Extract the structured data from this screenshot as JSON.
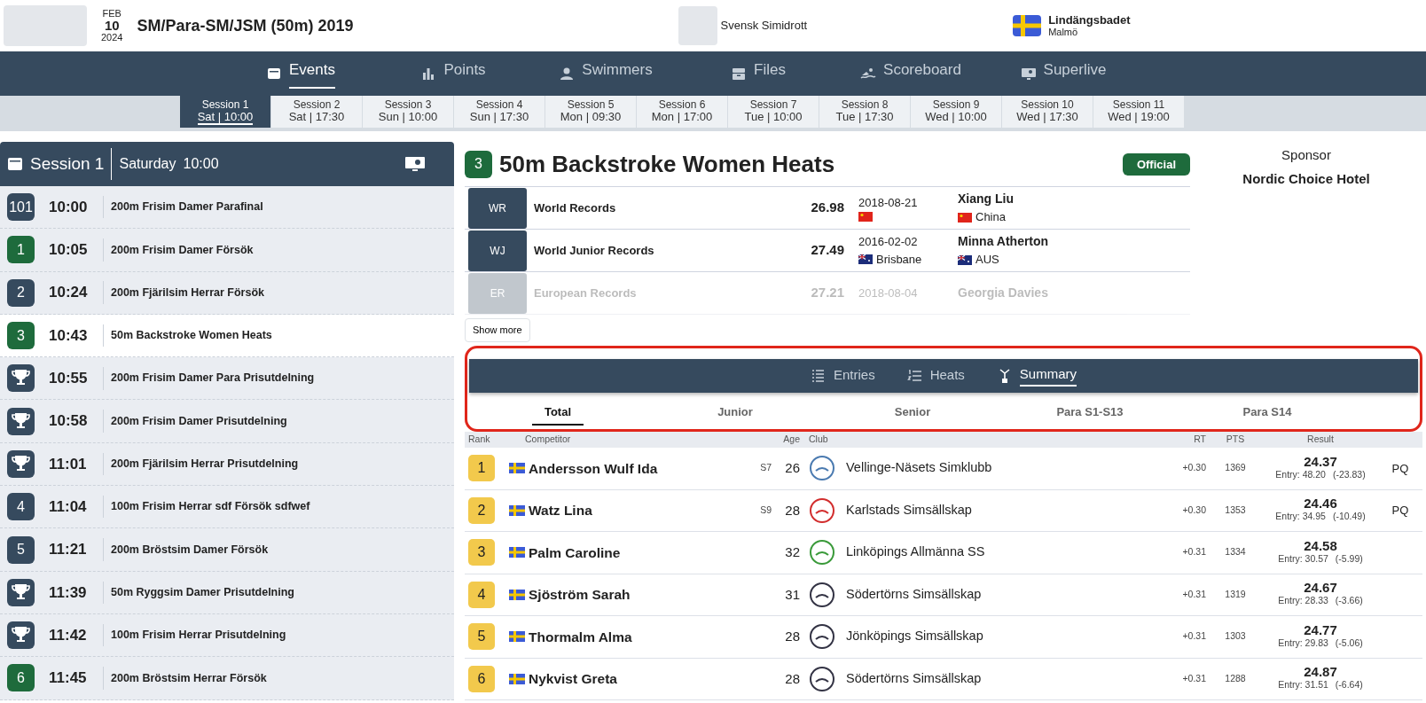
{
  "header": {
    "date": {
      "month": "FEB",
      "day": "10",
      "year": "2024"
    },
    "title": "SM/Para-SM/JSM (50m) 2019",
    "organizer": "Svensk Simidrott",
    "venue": {
      "name": "Lindängsbadet",
      "city": "Malmö"
    }
  },
  "nav": [
    {
      "label": "Events",
      "selected": true
    },
    {
      "label": "Points",
      "selected": false
    },
    {
      "label": "Swimmers",
      "selected": false
    },
    {
      "label": "Files",
      "selected": false
    },
    {
      "label": "Scoreboard",
      "selected": false
    },
    {
      "label": "Superlive",
      "selected": false
    }
  ],
  "sessions": [
    {
      "label": "Session 1",
      "time": "Sat | 10:00",
      "selected": true
    },
    {
      "label": "Session 2",
      "time": "Sat | 17:30",
      "selected": false
    },
    {
      "label": "Session 3",
      "time": "Sun | 10:00",
      "selected": false
    },
    {
      "label": "Session 4",
      "time": "Sun | 17:30",
      "selected": false
    },
    {
      "label": "Session 5",
      "time": "Mon | 09:30",
      "selected": false
    },
    {
      "label": "Session 6",
      "time": "Mon | 17:00",
      "selected": false
    },
    {
      "label": "Session 7",
      "time": "Tue | 10:00",
      "selected": false
    },
    {
      "label": "Session 8",
      "time": "Tue | 17:30",
      "selected": false
    },
    {
      "label": "Session 9",
      "time": "Wed | 10:00",
      "selected": false
    },
    {
      "label": "Session 10",
      "time": "Wed | 17:30",
      "selected": false
    },
    {
      "label": "Session 11",
      "time": "Wed | 19:00",
      "selected": false
    }
  ],
  "session_panel": {
    "title": "Session 1",
    "day": "Saturday",
    "time": "10:00"
  },
  "events": [
    {
      "kind": "number",
      "number": "101",
      "color": "#364a5e",
      "time": "10:00",
      "name": "200m Frisim Damer Parafinal",
      "selected": false
    },
    {
      "kind": "number",
      "number": "1",
      "color": "#1e6b3c",
      "time": "10:05",
      "name": "200m Frisim Damer Försök",
      "selected": false
    },
    {
      "kind": "number",
      "number": "2",
      "color": "#364a5e",
      "time": "10:24",
      "name": "200m Fjärilsim Herrar Försök",
      "selected": false
    },
    {
      "kind": "number",
      "number": "3",
      "color": "#1e6b3c",
      "time": "10:43",
      "name": "50m Backstroke Women Heats",
      "selected": true
    },
    {
      "kind": "award",
      "color": "#364a5e",
      "time": "10:55",
      "name": "200m Frisim Damer Para Prisutdelning",
      "selected": false
    },
    {
      "kind": "award",
      "color": "#364a5e",
      "time": "10:58",
      "name": "200m Frisim Damer Prisutdelning",
      "selected": false
    },
    {
      "kind": "award",
      "color": "#364a5e",
      "time": "11:01",
      "name": "200m Fjärilsim Herrar Prisutdelning",
      "selected": false
    },
    {
      "kind": "number",
      "number": "4",
      "color": "#364a5e",
      "time": "11:04",
      "name": "100m Frisim Herrar sdf Försök sdfwef",
      "selected": false
    },
    {
      "kind": "number",
      "number": "5",
      "color": "#364a5e",
      "time": "11:21",
      "name": "200m Bröstsim Damer Försök",
      "selected": false
    },
    {
      "kind": "award",
      "color": "#364a5e",
      "time": "11:39",
      "name": "50m Ryggsim Damer Prisutdelning",
      "selected": false
    },
    {
      "kind": "award",
      "color": "#364a5e",
      "time": "11:42",
      "name": "100m Frisim Herrar Prisutdelning",
      "selected": false
    },
    {
      "kind": "number",
      "number": "6",
      "color": "#1e6b3c",
      "time": "11:45",
      "name": "200m Bröstsim Herrar Försök",
      "selected": false
    }
  ],
  "event": {
    "number": "3",
    "title": "50m Backstroke Women Heats",
    "status": "Official",
    "records": [
      {
        "code": "WR",
        "name": "World Records",
        "time": "26.98",
        "date": "2018-08-21",
        "place_flag": {
          "kind": "cn"
        },
        "holder": "Xiang Liu",
        "country": "China",
        "country_flag": {
          "kind": "cn"
        },
        "faded": false
      },
      {
        "code": "WJ",
        "name": "World Junior Records",
        "time": "27.49",
        "date": "2016-02-02",
        "place": "Brisbane",
        "place_flag": {
          "kind": "au"
        },
        "holder": "Minna Atherton",
        "country": "AUS",
        "country_flag": {
          "kind": "au"
        },
        "faded": false
      },
      {
        "code": "ER",
        "name": "European Records",
        "time": "27.21",
        "date": "2018-08-04",
        "holder": "Georgia Davies",
        "faded": true
      }
    ],
    "show_more": "Show more"
  },
  "sponsor": {
    "label": "Sponsor",
    "name": "Nordic Choice Hotel"
  },
  "tabs": [
    {
      "label": "Entries",
      "selected": false
    },
    {
      "label": "Heats",
      "selected": false
    },
    {
      "label": "Summary",
      "selected": true
    }
  ],
  "categories": [
    {
      "label": "Total",
      "selected": true
    },
    {
      "label": "Junior",
      "selected": false
    },
    {
      "label": "Senior",
      "selected": false
    },
    {
      "label": "Para S1-S13",
      "selected": false
    },
    {
      "label": "Para S14",
      "selected": false
    }
  ],
  "results": {
    "columns": [
      "Rank",
      "Competitor",
      "Age",
      "Club",
      "RT",
      "PTS",
      "Result"
    ],
    "rows": [
      {
        "rank": "1",
        "flag": {
          "kind": "se"
        },
        "name": "Andersson Wulf Ida",
        "class": "S7",
        "age": "26",
        "club": "Vellinge-Näsets Simklubb",
        "rt": "+0.30",
        "pts": "1369",
        "result": "24.37",
        "entry": "Entry: 48.20",
        "diff": "(-23.83)",
        "qualification": "PQ"
      },
      {
        "rank": "2",
        "flag": {
          "kind": "se"
        },
        "name": "Watz Lina",
        "class": "S9",
        "age": "28",
        "club": "Karlstads Simsällskap",
        "rt": "+0.30",
        "pts": "1353",
        "result": "24.46",
        "entry": "Entry: 34.95",
        "diff": "(-10.49)",
        "qualification": "PQ"
      },
      {
        "rank": "3",
        "flag": {
          "kind": "se"
        },
        "name": "Palm Caroline",
        "age": "32",
        "club": "Linköpings Allmänna SS",
        "rt": "+0.31",
        "pts": "1334",
        "result": "24.58",
        "entry": "Entry: 30.57",
        "diff": "(-5.99)"
      },
      {
        "rank": "4",
        "flag": {
          "kind": "se"
        },
        "name": "Sjöström Sarah",
        "age": "31",
        "club": "Södertörns Simsällskap",
        "rt": "+0.31",
        "pts": "1319",
        "result": "24.67",
        "entry": "Entry: 28.33",
        "diff": "(-3.66)"
      },
      {
        "rank": "5",
        "flag": {
          "kind": "se"
        },
        "name": "Thormalm Alma",
        "age": "28",
        "club": "Jönköpings Simsällskap",
        "rt": "+0.31",
        "pts": "1303",
        "result": "24.77",
        "entry": "Entry: 29.83",
        "diff": "(-5.06)"
      },
      {
        "rank": "6",
        "flag": {
          "kind": "se"
        },
        "name": "Nykvist Greta",
        "age": "28",
        "club": "Södertörns Simsällskap",
        "rt": "+0.31",
        "pts": "1288",
        "result": "24.87",
        "entry": "Entry: 31.51",
        "diff": "(-6.64)"
      }
    ]
  }
}
